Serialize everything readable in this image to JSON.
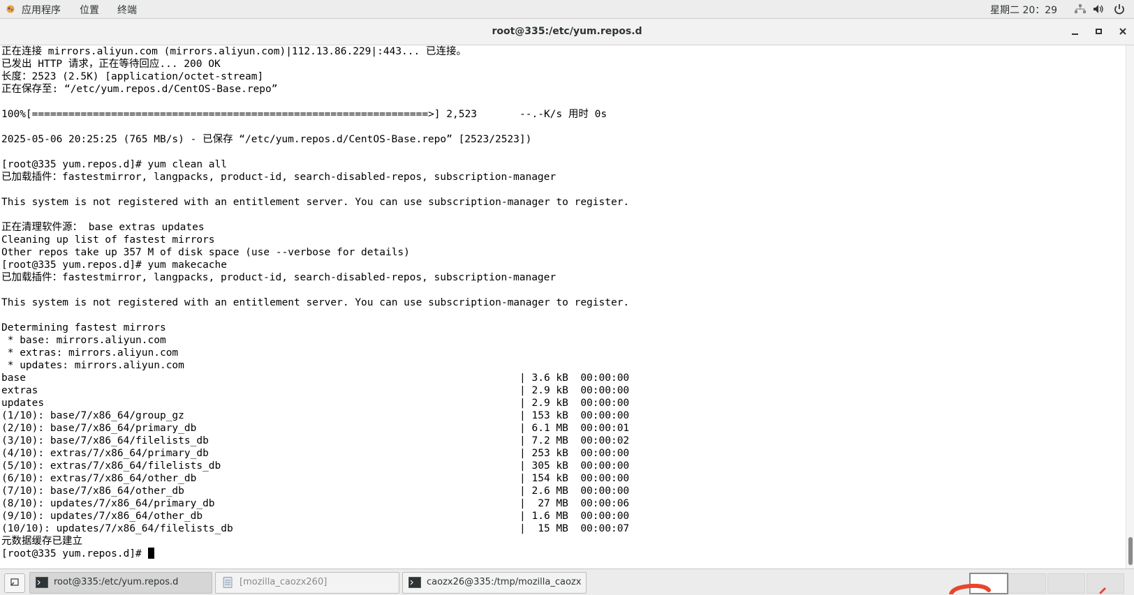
{
  "topbar": {
    "applications": "应用程序",
    "places": "位置",
    "terminal_menu": "终端",
    "clock": "星期二 20：29",
    "icons": [
      "network-icon",
      "volume-icon",
      "power-icon"
    ]
  },
  "window": {
    "title": "root@335:/etc/yum.repos.d",
    "buttons": [
      "minimize",
      "maximize",
      "close"
    ]
  },
  "terminal": {
    "lines": [
      "正在连接 mirrors.aliyun.com (mirrors.aliyun.com)|112.13.86.229|:443... 已连接。",
      "已发出 HTTP 请求，正在等待回应... 200 OK",
      "长度：2523 (2.5K) [application/octet-stream]",
      "正在保存至: “/etc/yum.repos.d/CentOS-Base.repo”",
      "",
      "100%[=================================================================>] 2,523       --.-K/s 用时 0s",
      "",
      "2025-05-06 20:25:25 (765 MB/s) - 已保存 “/etc/yum.repos.d/CentOS-Base.repo” [2523/2523])",
      "",
      "[root@335 yum.repos.d]# yum clean all",
      "已加载插件：fastestmirror, langpacks, product-id, search-disabled-repos, subscription-manager",
      "",
      "This system is not registered with an entitlement server. You can use subscription-manager to register.",
      "",
      "正在清理软件源： base extras updates",
      "Cleaning up list of fastest mirrors",
      "Other repos take up 357 M of disk space (use --verbose for details)",
      "[root@335 yum.repos.d]# yum makecache",
      "已加载插件：fastestmirror, langpacks, product-id, search-disabled-repos, subscription-manager",
      "",
      "This system is not registered with an entitlement server. You can use subscription-manager to register.",
      "",
      "Determining fastest mirrors",
      " * base: mirrors.aliyun.com",
      " * extras: mirrors.aliyun.com",
      " * updates: mirrors.aliyun.com",
      "base                                                                                 | 3.6 kB  00:00:00",
      "extras                                                                               | 2.9 kB  00:00:00",
      "updates                                                                              | 2.9 kB  00:00:00",
      "(1/10): base/7/x86_64/group_gz                                                       | 153 kB  00:00:00",
      "(2/10): base/7/x86_64/primary_db                                                     | 6.1 MB  00:00:01",
      "(3/10): base/7/x86_64/filelists_db                                                   | 7.2 MB  00:00:02",
      "(4/10): extras/7/x86_64/primary_db                                                   | 253 kB  00:00:00",
      "(5/10): extras/7/x86_64/filelists_db                                                 | 305 kB  00:00:00",
      "(6/10): extras/7/x86_64/other_db                                                     | 154 kB  00:00:00",
      "(7/10): base/7/x86_64/other_db                                                       | 2.6 MB  00:00:00",
      "(8/10): updates/7/x86_64/primary_db                                                  |  27 MB  00:00:06",
      "(9/10): updates/7/x86_64/other_db                                                    | 1.6 MB  00:00:00",
      "(10/10): updates/7/x86_64/filelists_db                                               |  15 MB  00:00:07",
      "元数据缓存已建立"
    ],
    "prompt": "[root@335 yum.repos.d]# "
  },
  "taskbar": {
    "tasks": [
      {
        "label": "root@335:/etc/yum.repos.d",
        "icon": "terminal-icon"
      },
      {
        "label": "[mozilla_caozx260]",
        "icon": "file-icon"
      },
      {
        "label": "caozx26@335:/tmp/mozilla_caozx···",
        "icon": "terminal-icon"
      }
    ]
  }
}
